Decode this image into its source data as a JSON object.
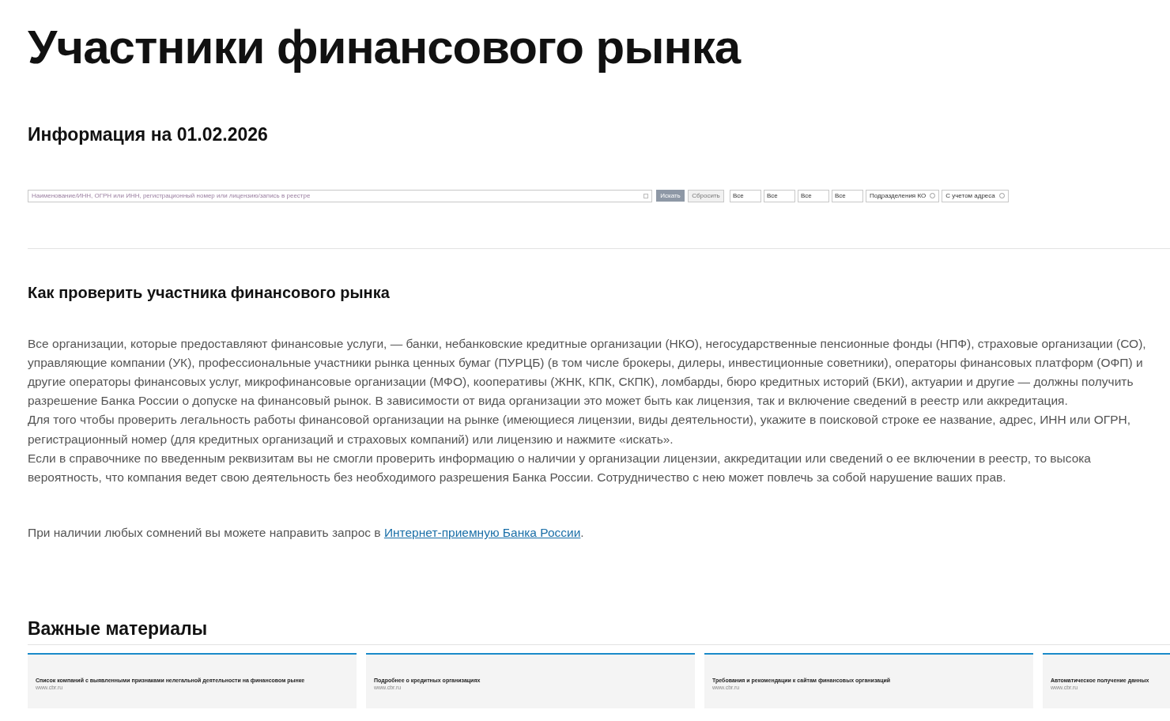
{
  "title": "Участники финансового рынка",
  "info_date": "Информация на 01.02.2026",
  "search": {
    "placeholder": "Наименование/ИНН, ОГРН или ИНН, регистрационный номер или лицензию/запись в реестре",
    "buttons": [
      {
        "label": "Искать",
        "kind": "primary"
      },
      {
        "label": "Сбросить",
        "kind": "secondary"
      }
    ],
    "filters": [
      {
        "value": "Все",
        "kind": "select"
      },
      {
        "value": "Все",
        "kind": "select"
      },
      {
        "value": "Все",
        "kind": "select"
      },
      {
        "value": "Все",
        "kind": "select"
      },
      {
        "value": "Подразделения КО",
        "kind": "toggle"
      },
      {
        "value": "С учетом адреса",
        "kind": "toggle"
      }
    ]
  },
  "how_to": {
    "heading": "Как проверить участника финансового рынка",
    "paragraphs": [
      "Все организации, которые предоставляют финансовые услуги, — банки, небанковские кредитные организации (НКО), негосударственные пенсионные фонды (НПФ), страховые организации (СО), управляющие компании (УК), профессиональные участники рынка ценных бумаг (ПУРЦБ) (в том числе брокеры, дилеры, инвестиционные советники), операторы финансовых платформ (ОФП) и другие операторы финансовых услуг, микрофинансовые организации (МФО), кооперативы (ЖНК, КПК, СКПК), ломбарды, бюро кредитных историй (БКИ), актуарии и другие — должны получить разрешение Банка России о допуске на финансовый рынок. В зависимости от вида организации это может быть как лицензия, так и включение сведений в реестр или аккредитация.",
      "Для того чтобы проверить легальность работы финансовой организации на рынке (имеющиеся лицензии, виды деятельности), укажите в поисковой строке ее название, адрес, ИНН или ОГРН, регистрационный номер (для кредитных организаций и страховых компаний) или лицензию и нажмите «искать».",
      "Если в справочнике по введенным реквизитам вы не смогли проверить информацию о наличии у организации лицензии, аккредитации или сведений о ее включении в реестр, то высока вероятность, что компания ведет свою деятельность без необходимого разрешения Банка России. Сотрудничество с нею может повлечь за собой нарушение ваших прав."
    ],
    "contact_text": "При наличии любых сомнений вы можете направить запрос в ",
    "contact_link": "Интернет-приемную Банка России",
    "contact_end": "."
  },
  "materials": {
    "heading": "Важные материалы",
    "cards": [
      {
        "title": "Список компаний с выявленными признаками нелегальной деятельности на финансовом рынке",
        "source": "www.cbr.ru"
      },
      {
        "title": "Подробнее о кредитных организациях",
        "source": "www.cbr.ru"
      },
      {
        "title": "Требования и рекомендации к сайтам финансовых организаций",
        "source": "www.cbr.ru"
      },
      {
        "title": "Автоматическое получение данных",
        "source": "www.cbr.ru"
      }
    ]
  }
}
